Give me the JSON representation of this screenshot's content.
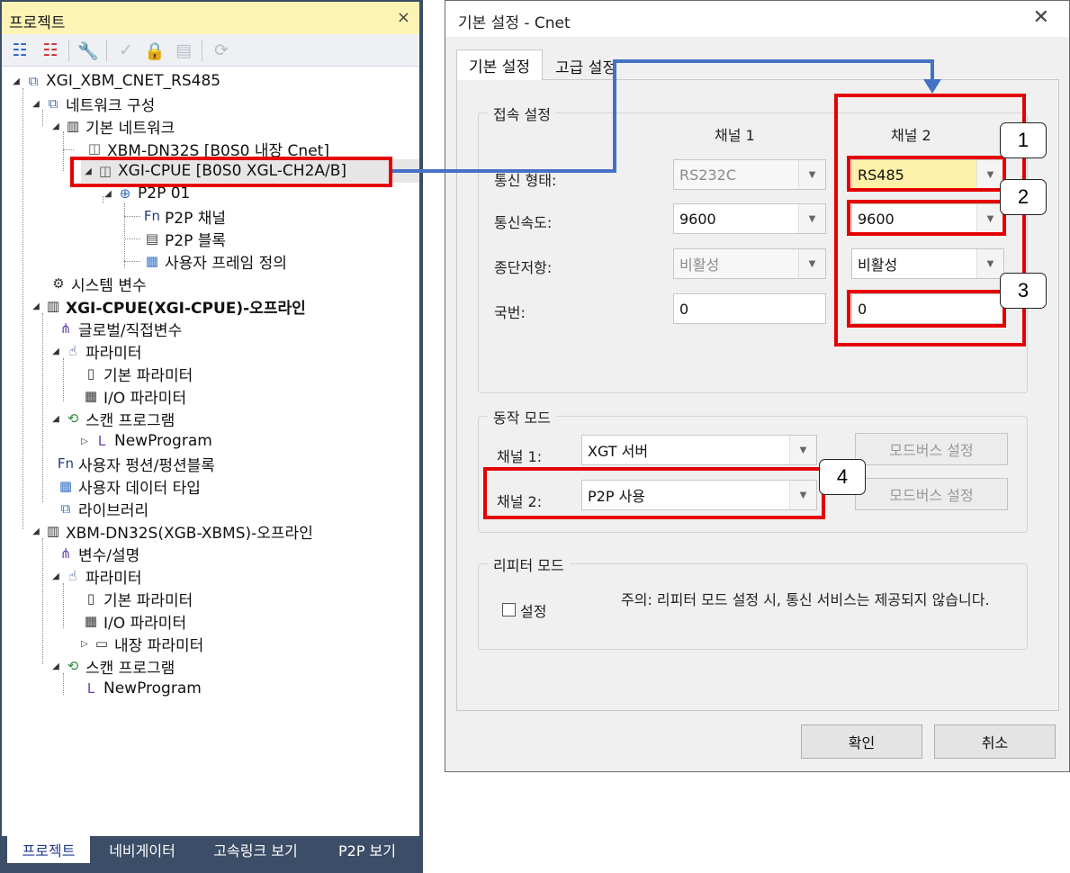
{
  "project_panel": {
    "title": "프로젝트",
    "close": "×",
    "tree": [
      {
        "label": "XGI_XBM_CNET_RS485",
        "icon": "network-project-icon",
        "bold": false
      },
      {
        "label": "네트워크 구성",
        "icon": "network-config-icon",
        "bold": false
      },
      {
        "label": "기본 네트워크",
        "icon": "module-icon",
        "bold": false
      },
      {
        "label": "XBM-DN32S [B0S0 내장 Cnet]",
        "icon": "cnet-icon",
        "bold": false
      },
      {
        "label": "XGI-CPUE [B0S0 XGL-CH2A/B]",
        "icon": "cnet-icon",
        "bold": false
      },
      {
        "label": "P2P 01",
        "icon": "p2p-globe-icon",
        "bold": false
      },
      {
        "label": "P2P 채널",
        "icon": "function-icon",
        "bold": false
      },
      {
        "label": "P2P 블록",
        "icon": "block-icon",
        "bold": false
      },
      {
        "label": "사용자 프레임 정의",
        "icon": "user-frame-icon",
        "bold": false
      },
      {
        "label": "시스템 변수",
        "icon": "system-variable-icon",
        "bold": false
      },
      {
        "label": "XGI-CPUE(XGI-CPUE)-오프라인",
        "icon": "module-icon",
        "bold": true
      },
      {
        "label": "글로벌/직접변수",
        "icon": "global-variable-icon",
        "bold": false
      },
      {
        "label": "파라미터",
        "icon": "parameter-icon",
        "bold": false
      },
      {
        "label": "기본 파라미터",
        "icon": "document-icon",
        "bold": false
      },
      {
        "label": "I/O 파라미터",
        "icon": "io-parameter-icon",
        "bold": false
      },
      {
        "label": "스캔 프로그램",
        "icon": "scan-program-icon",
        "bold": false
      },
      {
        "label": "NewProgram",
        "icon": "ladder-program-icon",
        "bold": false
      },
      {
        "label": "사용자 펑션/펑션블록",
        "icon": "function-icon",
        "bold": false
      },
      {
        "label": "사용자 데이터 타입",
        "icon": "user-frame-icon",
        "bold": false
      },
      {
        "label": "라이브러리",
        "icon": "library-icon",
        "bold": false
      },
      {
        "label": "XBM-DN32S(XGB-XBMS)-오프라인",
        "icon": "module-icon",
        "bold": false
      },
      {
        "label": "변수/설명",
        "icon": "variable-comment-icon",
        "bold": false
      },
      {
        "label": "파라미터",
        "icon": "parameter-icon",
        "bold": false
      },
      {
        "label": "기본 파라미터",
        "icon": "document-icon",
        "bold": false
      },
      {
        "label": "I/O 파라미터",
        "icon": "io-parameter-icon",
        "bold": false
      },
      {
        "label": "내장 파라미터",
        "icon": "embedded-parameter-icon",
        "bold": false
      },
      {
        "label": "스캔 프로그램",
        "icon": "scan-program-icon",
        "bold": false
      },
      {
        "label": "NewProgram",
        "icon": "ladder-program-icon",
        "bold": false
      }
    ],
    "bottom_tabs": [
      "프로젝트",
      "네비게이터",
      "고속링크 보기",
      "P2P 보기"
    ]
  },
  "dialog": {
    "title": "기본 설정 - Cnet",
    "close": "✕",
    "tabs": [
      "기본 설정",
      "고급 설정"
    ],
    "connection_group": {
      "title": "접속 설정",
      "channel1_header": "채널 1",
      "channel2_header": "채널 2",
      "rows": [
        {
          "label": "통신 형태:",
          "ch1": "RS232C",
          "ch2": "RS485"
        },
        {
          "label": "통신속도:",
          "ch1": "9600",
          "ch2": "9600"
        },
        {
          "label": "종단저항:",
          "ch1": "비활성",
          "ch2": "비활성"
        },
        {
          "label": "국번:",
          "ch1": "0",
          "ch2": "0"
        }
      ]
    },
    "mode_group": {
      "title": "동작 모드",
      "rows": [
        {
          "label": "채널 1:",
          "value": "XGT 서버",
          "button": "모드버스 설정"
        },
        {
          "label": "채널 2:",
          "value": "P2P 사용",
          "button": "모드버스 설정"
        }
      ]
    },
    "repeater_group": {
      "title": "리피터 모드",
      "checkbox_label": "설정",
      "note": "주의: 리피터 모드 설정 시, 통신 서비스는 제공되지 않습니다."
    },
    "ok": "확인",
    "cancel": "취소"
  },
  "annotations": {
    "callouts": [
      "1",
      "2",
      "3",
      "4"
    ],
    "box_color": "#e50000",
    "arrow_color": "#4472c4"
  }
}
